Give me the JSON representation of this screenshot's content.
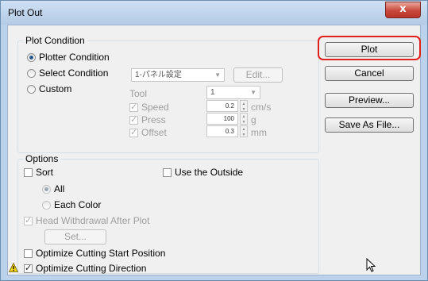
{
  "window": {
    "title": "Plot Out",
    "close_label": "x"
  },
  "plot_condition": {
    "group_label": "Plot Condition",
    "plotter_condition_label": "Plotter Condition",
    "select_condition_label": "Select Condition",
    "custom_label": "Custom",
    "select_combo_value": "1-パネル設定",
    "edit_button_label": "Edit...",
    "tool_label": "Tool",
    "tool_combo_value": "1",
    "speed_label": "Speed",
    "speed_value": "0.2",
    "speed_unit": "cm/s",
    "press_label": "Press",
    "press_value": "100",
    "press_unit": "g",
    "offset_label": "Offset",
    "offset_value": "0.3",
    "offset_unit": "mm"
  },
  "options": {
    "group_label": "Options",
    "sort_label": "Sort",
    "use_outside_label": "Use the Outside",
    "all_label": "All",
    "each_color_label": "Each Color",
    "head_withdrawal_label": "Head Withdrawal After Plot",
    "set_button_label": "Set...",
    "optimize_start_label": "Optimize Cutting Start Position",
    "optimize_direction_label": "Optimize Cutting Direction"
  },
  "actions": {
    "plot_label": "Plot",
    "cancel_label": "Cancel",
    "preview_label": "Preview...",
    "save_label": "Save As File..."
  },
  "colors": {
    "highlight": "#e0201a",
    "warning": "#f2d21c"
  },
  "icons": {
    "warning": "warning-icon",
    "cursor": "mouse-pointer-icon"
  }
}
